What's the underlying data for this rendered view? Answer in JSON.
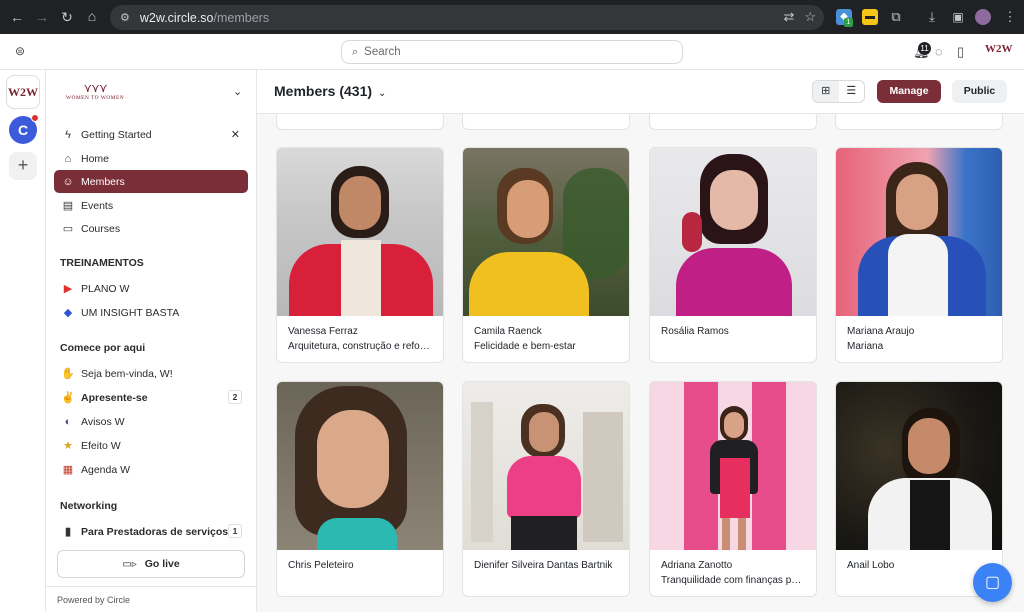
{
  "browser": {
    "url_host": "w2w.circle.so",
    "url_path": "/members",
    "ext_badge": "1"
  },
  "topbar": {
    "search_placeholder": "Search",
    "notification_count": "11",
    "brand_mark": "W2W"
  },
  "rail": {
    "community_logo": "W2W",
    "circle_avatar_letter": "C",
    "add_label": "+"
  },
  "sidebar": {
    "brand_text": "WOMEN TO WOMEN",
    "primary": [
      {
        "label": "Getting Started",
        "icon": "lightning-icon"
      },
      {
        "label": "Home",
        "icon": "home-icon"
      },
      {
        "label": "Members",
        "icon": "members-icon"
      },
      {
        "label": "Events",
        "icon": "calendar-icon"
      },
      {
        "label": "Courses",
        "icon": "courses-icon"
      }
    ],
    "sections": [
      {
        "title": "TREINAMENTOS",
        "items": [
          {
            "label": "PLANO W",
            "icon": "play-icon"
          },
          {
            "label": "UM INSIGHT BASTA",
            "icon": "diamond-icon"
          }
        ]
      },
      {
        "title": "Comece por aqui",
        "items": [
          {
            "label": "Seja bem-vinda, W!",
            "icon": "wave-emoji-icon"
          },
          {
            "label": "Apresente-se",
            "icon": "clap-emoji-icon",
            "count": "2"
          },
          {
            "label": "Avisos W",
            "icon": "speaking-emoji-icon"
          },
          {
            "label": "Efeito W",
            "icon": "starstruck-emoji-icon"
          },
          {
            "label": "Agenda W",
            "icon": "calendar-emoji-icon"
          }
        ]
      },
      {
        "title": "Networking",
        "items": [
          {
            "label": "Para Prestadoras de serviços",
            "icon": "door-emoji-icon",
            "count": "1"
          }
        ]
      }
    ],
    "go_live": "Go live",
    "powered_by": "Powered by Circle"
  },
  "main": {
    "title": "Members (431)",
    "manage": "Manage",
    "public": "Public",
    "members": [
      {
        "name": "Vanessa Ferraz",
        "headline": "Arquitetura, construção e refo…"
      },
      {
        "name": "Camila Raenck",
        "headline": "Felicidade e bem-estar"
      },
      {
        "name": "Rosália Ramos",
        "headline": ""
      },
      {
        "name": "Mariana Araujo",
        "headline": "Mariana"
      },
      {
        "name": "Chris Peleteiro",
        "headline": ""
      },
      {
        "name": "Dienifer Silveira Dantas Bartnik",
        "headline": ""
      },
      {
        "name": "Adriana Zanotto",
        "headline": "Tranquilidade com finanças p…"
      },
      {
        "name": "Anail Lobo",
        "headline": ""
      }
    ]
  },
  "colors": {
    "brand": "#7a2e38",
    "chat": "#3b82f6"
  }
}
